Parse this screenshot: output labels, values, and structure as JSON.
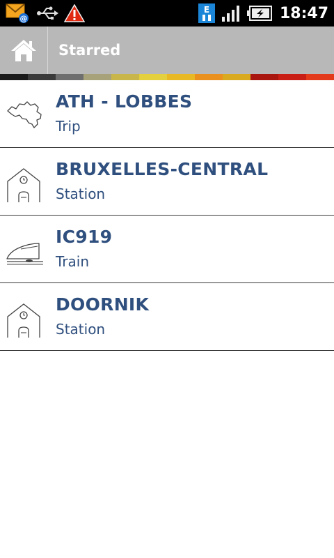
{
  "status_bar": {
    "time": "18:47",
    "icons": [
      "mail-at-icon",
      "usb-icon",
      "warning-icon",
      "edge-data-icon",
      "signal-icon",
      "battery-charging-icon"
    ]
  },
  "action_bar": {
    "home_icon": "home-icon",
    "title": "Starred"
  },
  "stripe_colors": [
    "#1a1a1a",
    "#3a3a3a",
    "#6e6e6e",
    "#a8a27a",
    "#c9b64a",
    "#e4cf3c",
    "#e9b825",
    "#e9901f",
    "#d9a91f",
    "#a8160f",
    "#c81e16",
    "#e23a1a"
  ],
  "items": [
    {
      "title": "ATH - LOBBES",
      "subtitle": "Trip",
      "icon": "belgium-map-icon"
    },
    {
      "title": "BRUXELLES-CENTRAL",
      "subtitle": "Station",
      "icon": "station-icon"
    },
    {
      "title": "IC919",
      "subtitle": "Train",
      "icon": "train-icon"
    },
    {
      "title": "DOORNIK",
      "subtitle": "Station",
      "icon": "station-icon"
    }
  ]
}
